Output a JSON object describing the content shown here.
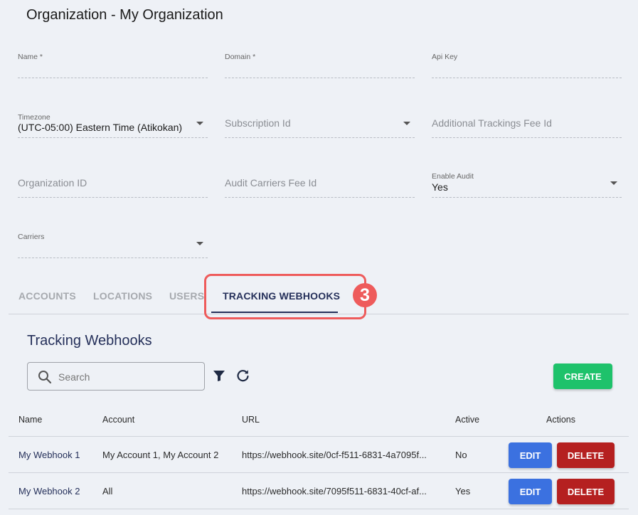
{
  "header": {
    "title": "Organization - My Organization"
  },
  "form": {
    "name": {
      "label": "Name *"
    },
    "domain": {
      "label": "Domain *"
    },
    "api_key": {
      "label": "Api Key"
    },
    "timezone": {
      "label": "Timezone",
      "value": "(UTC-05:00) Eastern Time (Atikokan)"
    },
    "subscription_id": {
      "placeholder": "Subscription Id"
    },
    "additional_trackings_fee_id": {
      "placeholder": "Additional Trackings Fee Id"
    },
    "organization_id": {
      "placeholder": "Organization ID"
    },
    "audit_carriers_fee_id": {
      "placeholder": "Audit Carriers Fee Id"
    },
    "enable_audit": {
      "label": "Enable Audit",
      "value": "Yes"
    },
    "carriers": {
      "label": "Carriers"
    }
  },
  "tabs": [
    {
      "label": "ACCOUNTS",
      "active": false
    },
    {
      "label": "LOCATIONS",
      "active": false
    },
    {
      "label": "USERS",
      "active": false
    },
    {
      "label": "TRACKING WEBHOOKS",
      "active": true
    }
  ],
  "annotation": {
    "step": "3",
    "color": "#ee5b5b"
  },
  "section": {
    "title": "Tracking Webhooks"
  },
  "toolbar": {
    "search_placeholder": "Search",
    "filter_icon": "filter-icon",
    "refresh_icon": "refresh-icon",
    "create_label": "CREATE"
  },
  "table": {
    "columns": [
      "Name",
      "Account",
      "URL",
      "Active",
      "Actions"
    ],
    "rows": [
      {
        "name": "My Webhook 1",
        "account": "My Account 1, My Account 2",
        "url": "https://webhook.site/0cf-f511-6831-4a7095f...",
        "active": "No",
        "edit": "EDIT",
        "delete": "DELETE"
      },
      {
        "name": "My Webhook 2",
        "account": "All",
        "url": "https://webhook.site/7095f511-6831-40cf-af...",
        "active": "Yes",
        "edit": "EDIT",
        "delete": "DELETE"
      }
    ]
  },
  "colors": {
    "accent": "#25305a",
    "create": "#1ec26b",
    "edit": "#3b71e0",
    "delete": "#b52020",
    "background": "#eef1f6"
  }
}
